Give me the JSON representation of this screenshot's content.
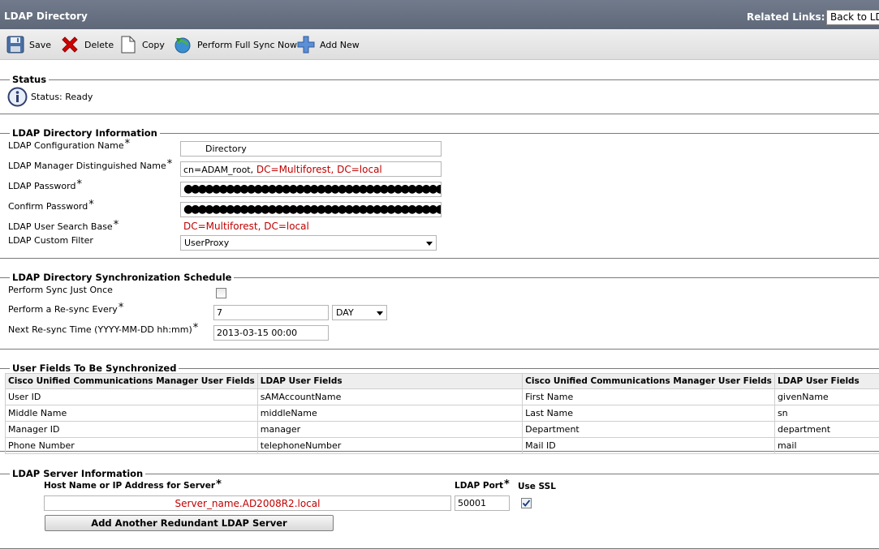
{
  "header": {
    "title": "LDAP Directory",
    "related_links_label": "Related Links:",
    "related_links_value": "Back to LDAP Directory Find/List"
  },
  "toolbar": {
    "save": "Save",
    "delete": "Delete",
    "copy": "Copy",
    "full_sync": "Perform Full Sync Now",
    "add_new": "Add New"
  },
  "status": {
    "legend": "Status",
    "text": "Status: Ready"
  },
  "info": {
    "legend": "LDAP Directory Information",
    "config_name_label": "LDAP Configuration Name",
    "config_name_value": "Directory",
    "manager_dn_label": "LDAP Manager Distinguished Name",
    "manager_dn_value_prefix": "cn=ADAM_root,",
    "manager_dn_value_red": " DC=Multiforest, DC=local",
    "password_label": "LDAP Password",
    "password_mask": "●●●●●●●●●●●●●●●●●●●●●●●●●●●●●●●●●●●●●●●●●●●●●●●●●●●●●●●●●●●●●●●●●●●●●●●",
    "confirm_password_label": "Confirm Password",
    "confirm_password_mask": "●●●●●●●●●●●●●●●●●●●●●●●●●●●●●●●●●●●●●●●●●●●●●●●●●●●●●●●●●●●●●●●●●●●●●●●",
    "search_base_label": "LDAP User Search Base",
    "search_base_value": "DC=Multiforest, DC=local",
    "custom_filter_label": "LDAP Custom Filter",
    "custom_filter_value": "UserProxy"
  },
  "schedule": {
    "legend": "LDAP Directory Synchronization Schedule",
    "sync_once_label": "Perform Sync Just Once",
    "sync_once_checked": false,
    "resync_label": "Perform a Re-sync Every",
    "resync_value": "7",
    "resync_unit": "DAY",
    "next_resync_label": "Next Re-sync Time (YYYY-MM-DD hh:mm)",
    "next_resync_value": "2013-03-15 00:00"
  },
  "user_fields": {
    "legend": "User Fields To Be Synchronized",
    "headers": [
      "Cisco Unified Communications Manager User Fields",
      "LDAP User Fields",
      "Cisco Unified Communications Manager User Fields",
      "LDAP User Fields"
    ],
    "rows": [
      [
        "User ID",
        "sAMAccountName",
        "First Name",
        "givenName"
      ],
      [
        "Middle Name",
        "middleName",
        "Last Name",
        "sn"
      ],
      [
        "Manager ID",
        "manager",
        "Department",
        "department"
      ],
      [
        "Phone Number",
        "telephoneNumber",
        "Mail ID",
        "mail"
      ]
    ]
  },
  "server": {
    "legend": "LDAP Server Information",
    "host_label": "Host Name or IP Address for Server",
    "host_value": "Server_name.AD2008R2.local",
    "port_label": "LDAP Port",
    "port_value": "50001",
    "ssl_label": "Use SSL",
    "ssl_checked": true,
    "add_button": "Add Another Redundant LDAP Server"
  },
  "required_mark": "*",
  "colors": {
    "header_bg": "#66707f",
    "red_text": "#c00000"
  }
}
